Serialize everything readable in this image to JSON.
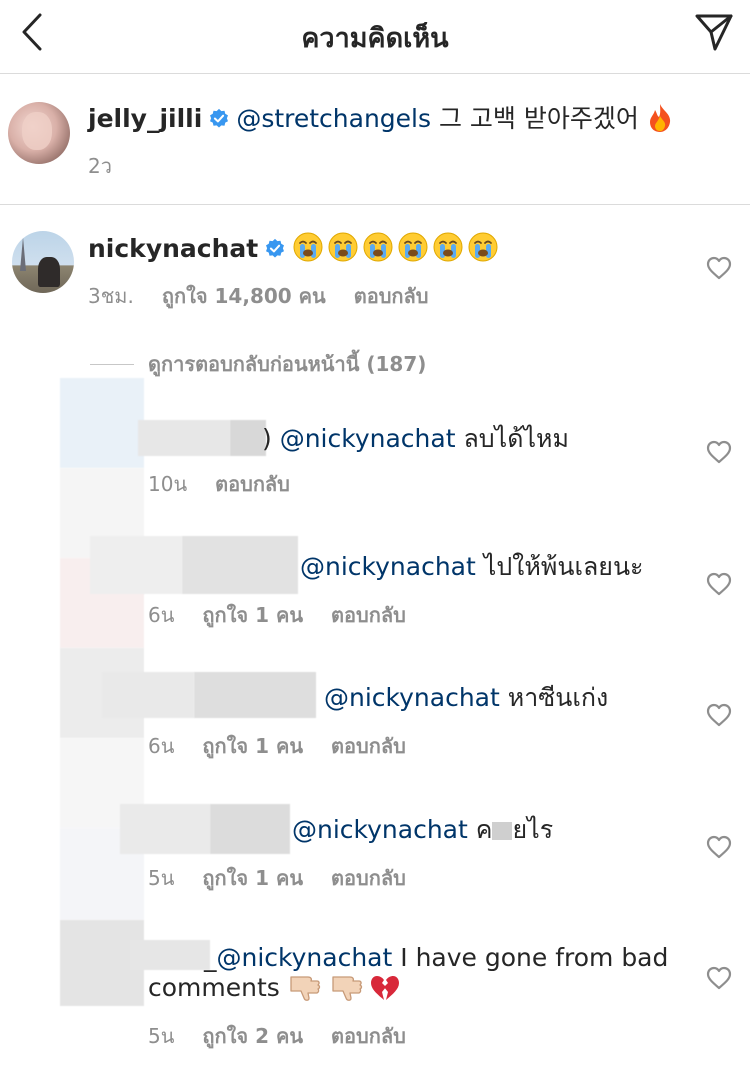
{
  "header": {
    "title": "ความคิดเห็น",
    "back_icon": "chevron-left-icon",
    "share_icon": "paper-plane-icon"
  },
  "caption": {
    "username": "jelly_jilli",
    "mention": "@stretchangels",
    "text": " 그 고백 받아주겠어 ",
    "emoji": "fire",
    "time": "2ว"
  },
  "top_comment": {
    "username": "nickynachat",
    "emojis": [
      "😭",
      "😭",
      "😭",
      "😭",
      "😭",
      "😭"
    ],
    "time": "3ชม.",
    "likes": "ถูกใจ 14,800 คน",
    "reply_label": "ตอบกลับ"
  },
  "view_previous": "ดูการตอบกลับก่อนหน้านี้ (187)",
  "replies": [
    {
      "mention": "@nickynachat",
      "text": " ลบได้ไหม",
      "time": "10น",
      "likes": "",
      "reply_label": "ตอบกลับ"
    },
    {
      "mention": "@nickynachat",
      "text": " ไปให้พ้นเลยนะ",
      "time": "6น",
      "likes": "ถูกใจ 1 คน",
      "reply_label": "ตอบกลับ"
    },
    {
      "mention": "@nickynachat",
      "text": " หาซีนเก่ง",
      "time": "6น",
      "likes": "ถูกใจ 1 คน",
      "reply_label": "ตอบกลับ"
    },
    {
      "mention": "@nickynachat",
      "text": " ค",
      "text_tail": "ยไร",
      "time": "5น",
      "likes": "ถูกใจ 1 คน",
      "reply_label": "ตอบกลับ"
    },
    {
      "mention": "@nickynachat",
      "text": "  I have gone from bad",
      "text_line2": "comments ",
      "time": "5น",
      "likes": "ถูกใจ 2 คน",
      "reply_label": "ตอบกลับ"
    }
  ],
  "colors": {
    "mention": "#003569",
    "text": "#262626",
    "meta": "#8e8e8e",
    "verified": "#3897f0",
    "divider": "#dbdbdb"
  }
}
